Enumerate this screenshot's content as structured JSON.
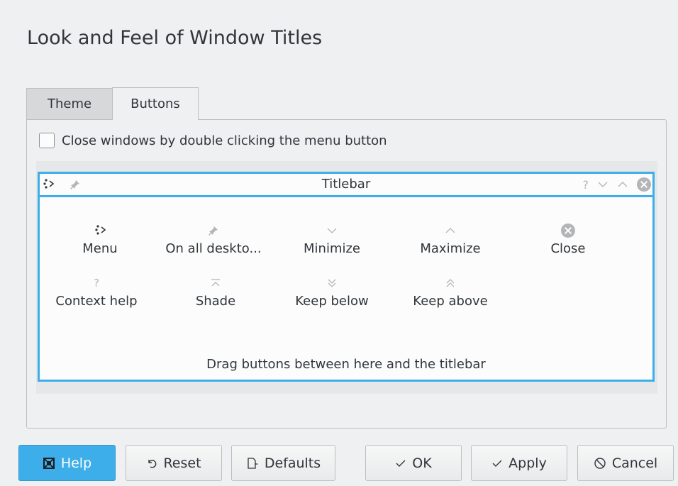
{
  "page": {
    "title": "Look and Feel of Window Titles"
  },
  "tabs": [
    {
      "label": "Theme",
      "active": false
    },
    {
      "label": "Buttons",
      "active": true
    }
  ],
  "options": {
    "close_double_click_label": "Close windows by double clicking the menu button",
    "close_double_click_checked": false
  },
  "titlebar": {
    "title": "Titlebar",
    "left_buttons": [
      "menu-icon",
      "pin-icon"
    ],
    "right_buttons": [
      "help-icon",
      "minimize-icon",
      "maximize-icon",
      "close-icon"
    ]
  },
  "available_buttons": [
    {
      "label": "Menu",
      "icon": "menu-icon"
    },
    {
      "label": "On all deskto...",
      "icon": "pin-icon"
    },
    {
      "label": "Minimize",
      "icon": "minimize-icon"
    },
    {
      "label": "Maximize",
      "icon": "maximize-icon"
    },
    {
      "label": "Close",
      "icon": "close-icon"
    },
    {
      "label": "Context help",
      "icon": "help-icon"
    },
    {
      "label": "Shade",
      "icon": "shade-icon"
    },
    {
      "label": "Keep below",
      "icon": "keep-below-icon"
    },
    {
      "label": "Keep above",
      "icon": "keep-above-icon"
    }
  ],
  "drag_hint": "Drag buttons between here and the titlebar",
  "footer": {
    "help": "Help",
    "reset": "Reset",
    "defaults": "Defaults",
    "ok": "OK",
    "apply": "Apply",
    "cancel": "Cancel"
  },
  "colors": {
    "accent": "#3daee9",
    "background": "#eff0f1",
    "text": "#31363b",
    "icon_muted": "#b3b5b8"
  }
}
